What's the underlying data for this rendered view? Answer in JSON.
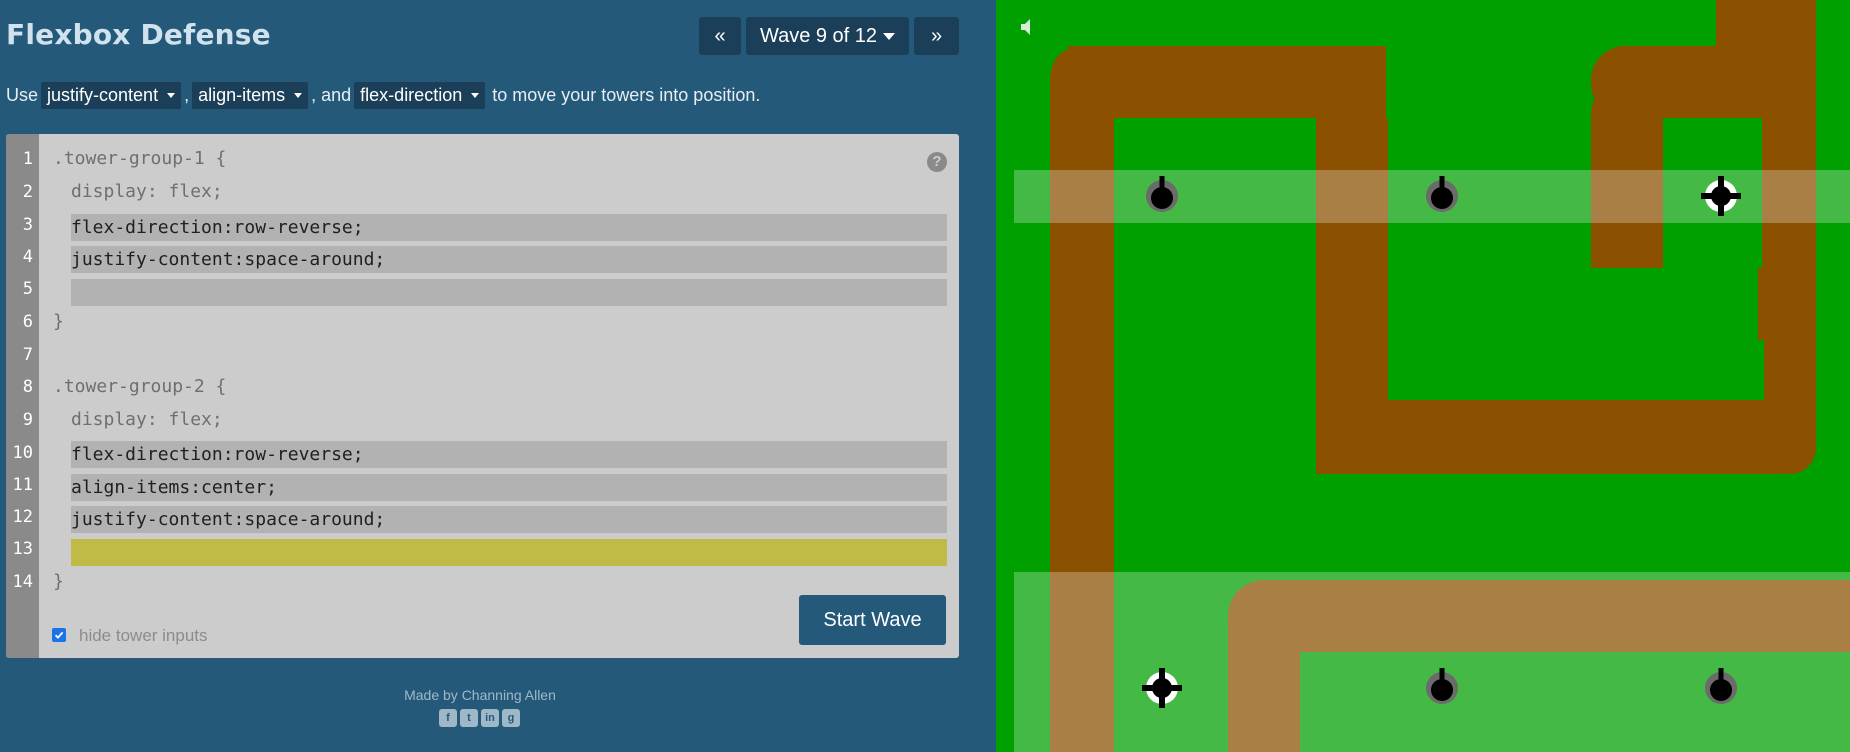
{
  "header": {
    "title": "Flexbox Defense",
    "prev_label": "«",
    "wave_label": "Wave 9 of 12",
    "next_label": "»"
  },
  "instructions": {
    "prefix": "Use",
    "prop1": "justify-content",
    "sep1": ",",
    "prop2": "align-items",
    "sep2": ", and",
    "prop3": "flex-direction",
    "suffix": "to move your towers into position."
  },
  "editor": {
    "line_numbers": [
      "1",
      "2",
      "3",
      "4",
      "5",
      "6",
      "7",
      "8",
      "9",
      "10",
      "11",
      "12",
      "13",
      "14"
    ],
    "group1_selector": ".tower-group-1 {",
    "group1_display": "display: flex;",
    "group1_inputs": [
      "flex-direction:row-reverse;",
      "justify-content:space-around;",
      ""
    ],
    "group1_close": "}",
    "group2_selector": ".tower-group-2 {",
    "group2_display": "display: flex;",
    "group2_inputs": [
      "flex-direction:row-reverse;",
      "align-items:center;",
      "justify-content:space-around;",
      ""
    ],
    "group2_close": "}",
    "help_label": "?",
    "hide_inputs_label": "hide tower inputs",
    "hide_inputs_checked": true,
    "start_wave_label": "Start Wave"
  },
  "footer": {
    "credit": "Made by Channing Allen",
    "social_icons": [
      "facebook-icon",
      "twitter-icon",
      "linkedin-icon",
      "github-icon"
    ]
  },
  "board": {
    "grass_color": "#00a000",
    "path_color": "#8b5000",
    "tower_types": [
      "gun",
      "gun",
      "crosshair",
      "crosshair",
      "gun",
      "gun"
    ]
  },
  "colors": {
    "background": "#25597a",
    "dark_button": "#1b3f59",
    "editor_bg": "#cccccc",
    "active_input": "#bfbb46"
  }
}
